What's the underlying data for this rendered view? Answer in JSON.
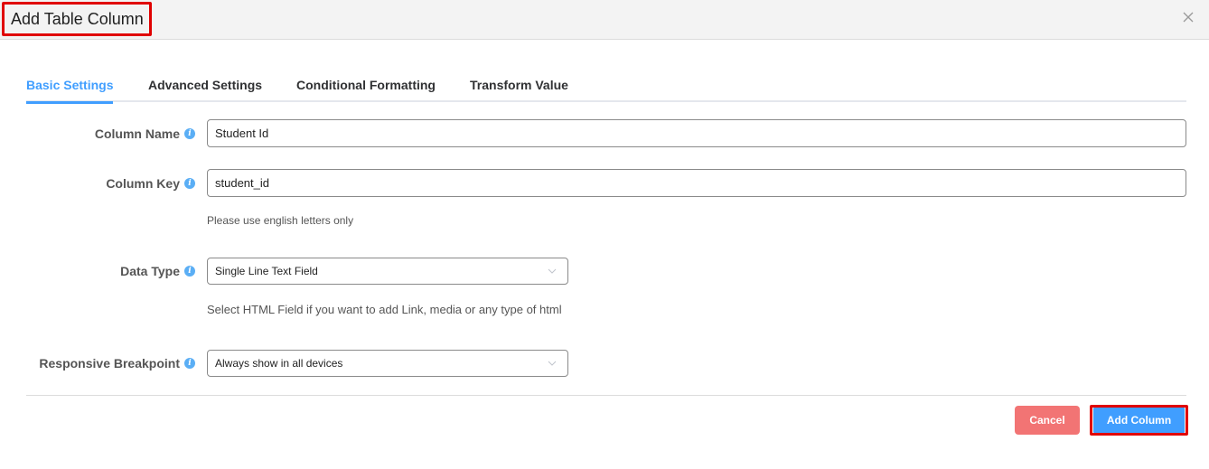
{
  "dialog": {
    "title": "Add Table Column",
    "close_icon": "close-icon"
  },
  "tabs": [
    {
      "label": "Basic Settings",
      "active": true
    },
    {
      "label": "Advanced Settings",
      "active": false
    },
    {
      "label": "Conditional Formatting",
      "active": false
    },
    {
      "label": "Transform Value",
      "active": false
    }
  ],
  "form": {
    "column_name": {
      "label": "Column Name",
      "value": "Student Id"
    },
    "column_key": {
      "label": "Column Key",
      "value": "student_id",
      "help": "Please use english letters only"
    },
    "data_type": {
      "label": "Data Type",
      "value": "Single Line Text Field",
      "help": "Select HTML Field if you want to add Link, media or any type of html"
    },
    "responsive_breakpoint": {
      "label": "Responsive Breakpoint",
      "value": "Always show in all devices"
    }
  },
  "footer": {
    "cancel_label": "Cancel",
    "add_label": "Add Column"
  },
  "colors": {
    "accent": "#409eff",
    "cancel": "#f27474",
    "highlight": "#e00000"
  }
}
